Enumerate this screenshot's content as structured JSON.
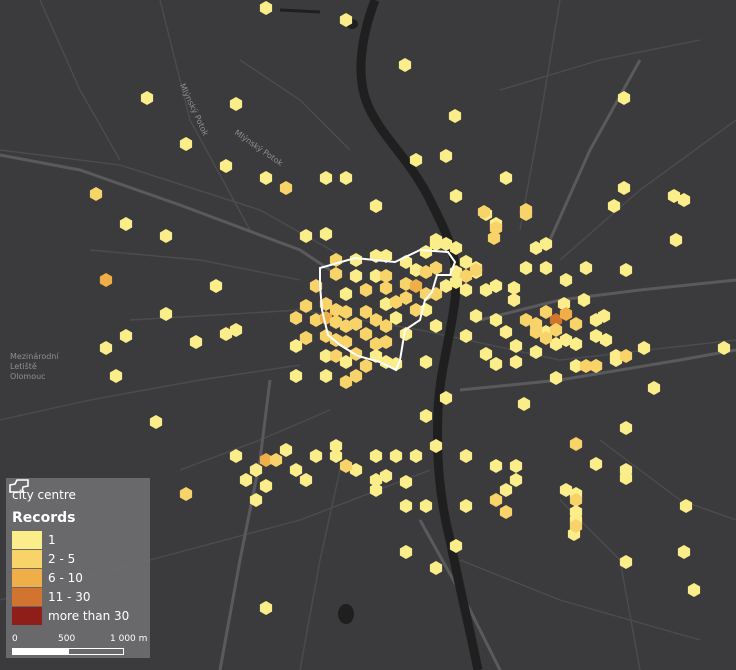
{
  "map": {
    "background_color": "#3b3b3d",
    "labels": {
      "airport": [
        "Mezinárodní",
        "Letiště",
        "Olomouc"
      ],
      "road_1": "Mlýnský Potok",
      "road_2": "Mlýnský Potok"
    }
  },
  "legend": {
    "city_centre_label": "city centre",
    "title": "Records",
    "classes": [
      {
        "label": "1",
        "color": "#fbee8a"
      },
      {
        "label": "2 - 5",
        "color": "#f7d36a"
      },
      {
        "label": "6 - 10",
        "color": "#f0ae48"
      },
      {
        "label": "11 - 30",
        "color": "#d0742f"
      },
      {
        "label": "more than 30",
        "color": "#8f1d1a"
      }
    ]
  },
  "scale_bar": {
    "labels": [
      "0",
      "500",
      "1 000 m"
    ]
  }
}
